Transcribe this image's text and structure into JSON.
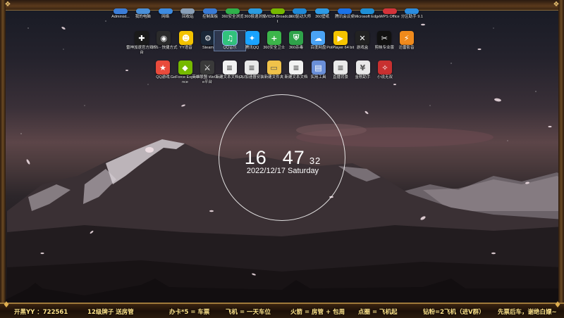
{
  "desktop": {
    "row0": [
      {
        "label": "Administ...",
        "color": "#3b7dd8",
        "icon": "user-folder-icon"
      },
      {
        "label": "我的电脑",
        "color": "#4a90d9",
        "icon": "computer-icon"
      },
      {
        "label": "网络",
        "color": "#3d8be0",
        "icon": "network-icon"
      },
      {
        "label": "回收站",
        "color": "#8aa0b8",
        "icon": "recycle-bin-icon"
      },
      {
        "label": "控制面板",
        "color": "#3a7bd5",
        "icon": "control-panel-icon"
      },
      {
        "label": "360安全浏览",
        "color": "#2fb14b",
        "icon": "browser-icon"
      },
      {
        "label": "360极速浏览",
        "color": "#2a9ce0",
        "icon": "browser-icon"
      },
      {
        "label": "NVIDIA Broadcast",
        "color": "#76b900",
        "icon": "nvidia-icon"
      },
      {
        "label": "360驱动大师",
        "color": "#1f8ad8",
        "icon": "driver-icon"
      },
      {
        "label": "360壁纸",
        "color": "#2d9be6",
        "icon": "wallpaper-icon"
      },
      {
        "label": "腾讯会议桌",
        "color": "#1a72e8",
        "icon": "meeting-icon"
      },
      {
        "label": "Microsoft Edge",
        "color": "#1e8fd6",
        "icon": "edge-icon"
      },
      {
        "label": "WPS Office",
        "color": "#d4333a",
        "icon": "wps-icon"
      },
      {
        "label": "分区助手 9.1",
        "color": "#2b8de0",
        "icon": "partition-icon"
      }
    ],
    "row1": [
      {
        "label": "雷神加速官方网平台",
        "color": "#1a1a1a",
        "glyph": "✚",
        "icon": "thunder-icon"
      },
      {
        "label": "OBS - 快捷方式",
        "color": "#2b2b2b",
        "glyph": "◉",
        "icon": "obs-icon"
      },
      {
        "label": "YY语音",
        "color": "#f2c200",
        "glyph": "☻",
        "icon": "yy-icon"
      },
      {
        "label": "Steam",
        "color": "#1b2838",
        "glyph": "⚙",
        "icon": "steam-icon"
      },
      {
        "label": "QQ音乐",
        "color": "#31c27c",
        "glyph": "♫",
        "icon": "qq-music-icon"
      },
      {
        "label": "腾讯QQ",
        "color": "#1aa3ff",
        "glyph": "✦",
        "icon": "qq-icon"
      },
      {
        "label": "360安全卫士",
        "color": "#3cb54a",
        "glyph": "+",
        "icon": "360-safe-icon"
      },
      {
        "label": "360杀毒",
        "color": "#2fa34a",
        "glyph": "⛨",
        "icon": "antivirus-icon"
      },
      {
        "label": "百度网盘",
        "color": "#4aa3f5",
        "glyph": "☁",
        "icon": "baidu-pan-icon"
      },
      {
        "label": "PotPlayer 64 bit",
        "color": "#f5c400",
        "glyph": "▶",
        "icon": "potplayer-icon"
      },
      {
        "label": "游戏盒",
        "color": "#222",
        "glyph": "✕",
        "icon": "game-box-icon"
      },
      {
        "label": "剪映专业版",
        "color": "#111",
        "glyph": "✂",
        "icon": "jianying-icon"
      },
      {
        "label": "迅雷影音",
        "color": "#f08a1c",
        "glyph": "⚡",
        "icon": "xunlei-icon"
      }
    ],
    "row2": [
      {
        "label": "QQ游戏",
        "color": "#e94b3c",
        "glyph": "★",
        "icon": "qq-game-icon"
      },
      {
        "label": "GeForce Experience",
        "color": "#76b900",
        "glyph": "◆",
        "icon": "geforce-icon"
      },
      {
        "label": "英雄联盟 WeGame平台",
        "color": "#3a3a3a",
        "glyph": "⚔",
        "icon": "league-icon"
      },
      {
        "label": "新建文本文档(2)",
        "color": "#f2f2f2",
        "glyph": "≡",
        "icon": "text-file-icon"
      },
      {
        "label": "UU加速器安装",
        "color": "#e8e8e8",
        "glyph": "≡",
        "icon": "file-icon"
      },
      {
        "label": "新建文件夹",
        "color": "#f0c24a",
        "glyph": "▭",
        "icon": "folder-icon"
      },
      {
        "label": "新建文本文档",
        "color": "#f2f2f2",
        "glyph": "≡",
        "icon": "text-file-icon"
      },
      {
        "label": "实用工具",
        "color": "#6a8fd8",
        "glyph": "▤",
        "icon": "tools-icon"
      },
      {
        "label": "直播背景",
        "color": "#eaeaea",
        "glyph": "≡",
        "icon": "file-icon"
      },
      {
        "label": "金税助手",
        "color": "#e8e8e8",
        "glyph": "¥",
        "icon": "tax-icon"
      },
      {
        "label": "小说无双",
        "color": "#c83030",
        "glyph": "✧",
        "icon": "novel-icon"
      }
    ]
  },
  "clock": {
    "hour": "16",
    "minute": "47",
    "second": "32",
    "date": "2022/12/17 Saturday"
  },
  "ticker": {
    "items": [
      "开黑YY ：722561",
      "12级牌子 送房管",
      "办卡*5 = 车票",
      "飞机 = 一天车位",
      "火箭 = 房管 + 包周",
      "点圈 = 飞机起",
      "钻粉=2飞机（进V群）",
      "先票后车，谢绝白嫖~"
    ]
  }
}
